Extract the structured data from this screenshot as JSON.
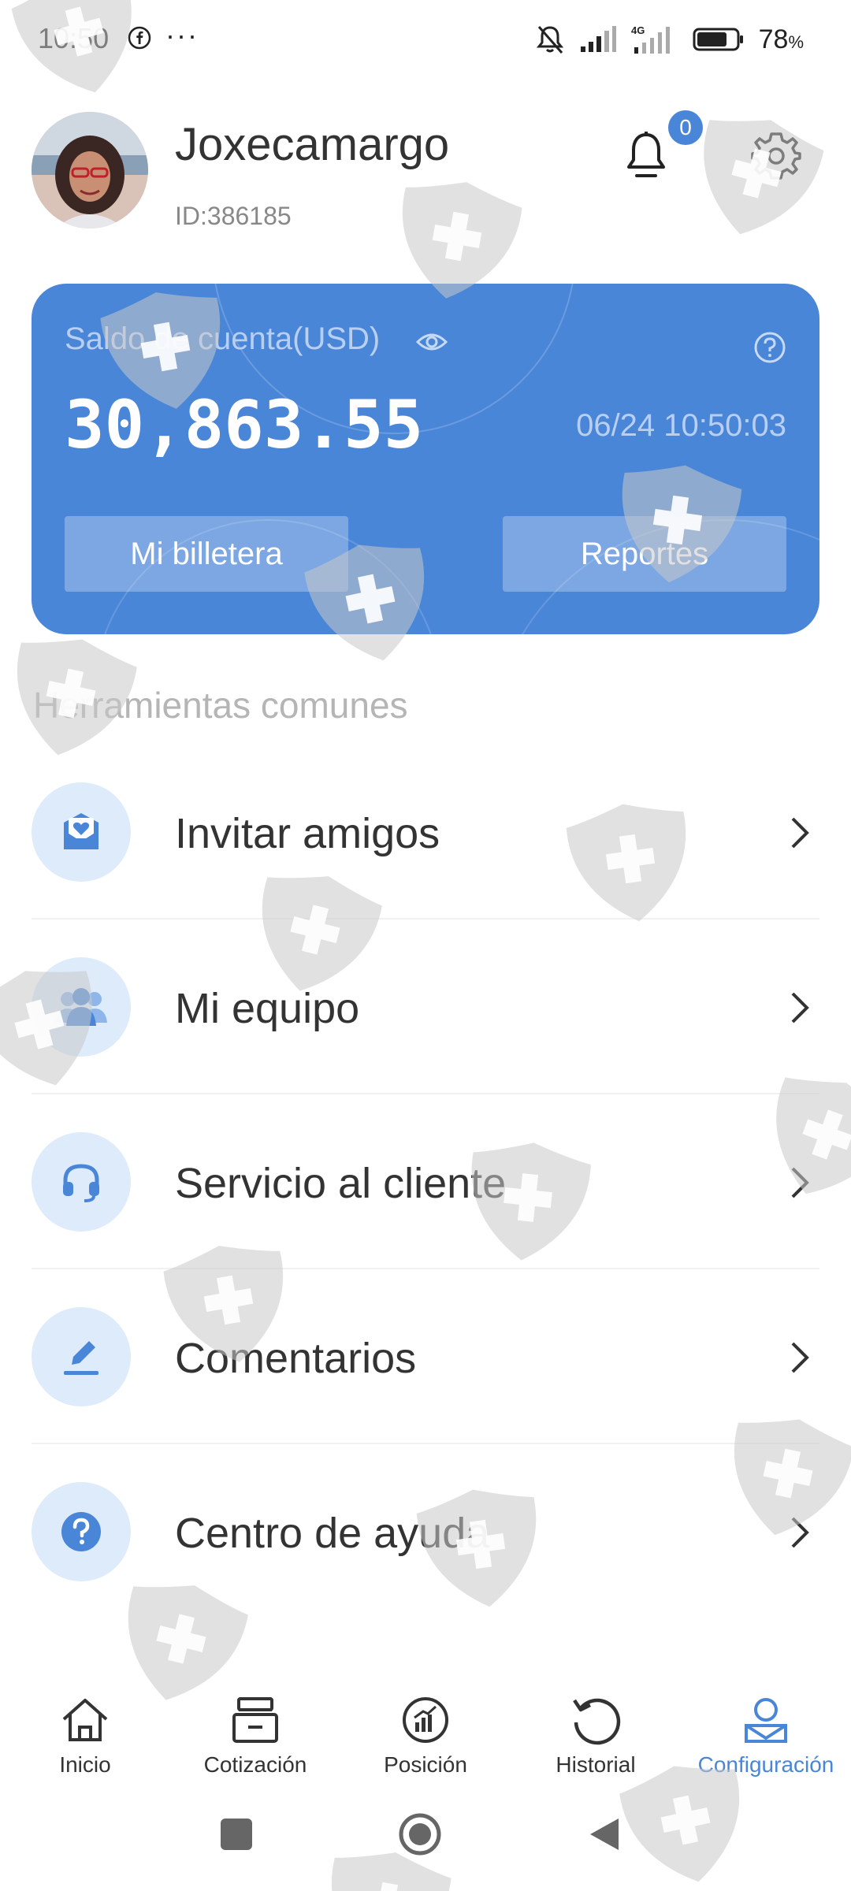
{
  "status_bar": {
    "time": "10:50",
    "more": "···",
    "network_type": "4G",
    "battery_percent": "78",
    "battery_unit": "%",
    "battery_level": 0.78,
    "icons": [
      "facebook-icon",
      "bell-muted-icon",
      "signal-icon",
      "signal-4g-icon",
      "battery-icon"
    ]
  },
  "profile": {
    "username": "Joxecamargo",
    "id_text": "ID:386185",
    "notification_count": "0",
    "icons": [
      "avatar",
      "bell-icon",
      "gear-icon"
    ]
  },
  "balance_card": {
    "label": "Saldo de cuenta(USD)",
    "amount": "30,863.55",
    "timestamp": "06/24 10:50:03",
    "wallet_button": "Mi billetera",
    "reports_button": "Reportes",
    "background_color": "#4a86d8"
  },
  "tools": {
    "title": "Herramientas comunes",
    "items": [
      {
        "label": "Invitar amigos",
        "icon": "invite-envelope-icon"
      },
      {
        "label": "Mi equipo",
        "icon": "team-icon"
      },
      {
        "label": "Servicio al cliente",
        "icon": "headset-icon"
      },
      {
        "label": "Comentarios",
        "icon": "pencil-icon"
      },
      {
        "label": "Centro de ayuda",
        "icon": "help-circle-icon"
      }
    ]
  },
  "bottom_nav": {
    "items": [
      {
        "label": "Inicio",
        "icon": "home-icon",
        "active": false
      },
      {
        "label": "Cotización",
        "icon": "quote-box-icon",
        "active": false
      },
      {
        "label": "Posición",
        "icon": "position-chart-icon",
        "active": false
      },
      {
        "label": "Historial",
        "icon": "history-icon",
        "active": false
      },
      {
        "label": "Configuración",
        "icon": "profile-settings-icon",
        "active": true
      }
    ],
    "active_color": "#4a86d8"
  },
  "colors": {
    "accent": "#4a86d8",
    "icon_circle": "#deebfb",
    "section_title": "#b5b5b5"
  }
}
